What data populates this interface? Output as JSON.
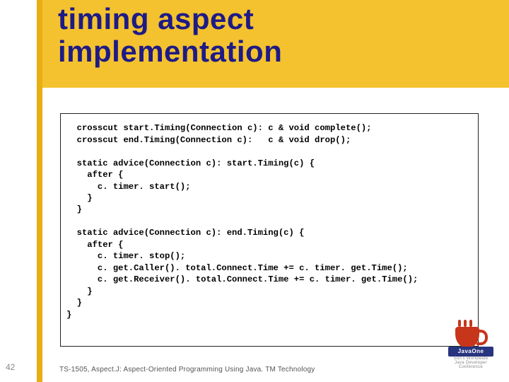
{
  "title_line1": "timing aspect",
  "title_line2": "implementation",
  "code": "  crosscut start.Timing(Connection c): c & void complete();\n  crosscut end.Timing(Connection c):   c & void drop();\n\n  static advice(Connection c): start.Timing(c) {\n    after {\n      c. timer. start();\n    }\n  }\n\n  static advice(Connection c): end.Timing(c) {\n    after {\n      c. timer. stop();\n      c. get.Caller(). total.Connect.Time += c. timer. get.Time();\n      c. get.Receiver(). total.Connect.Time += c. timer. get.Time();\n    }\n  }\n}",
  "slide_number": "42",
  "footer": "TS-1505, Aspect.J: Aspect-Oriented Programming Using Java. TM Technology",
  "logo_band": "JavaOne",
  "logo_sub": "Sun's Worldwide Java Developer Conference"
}
